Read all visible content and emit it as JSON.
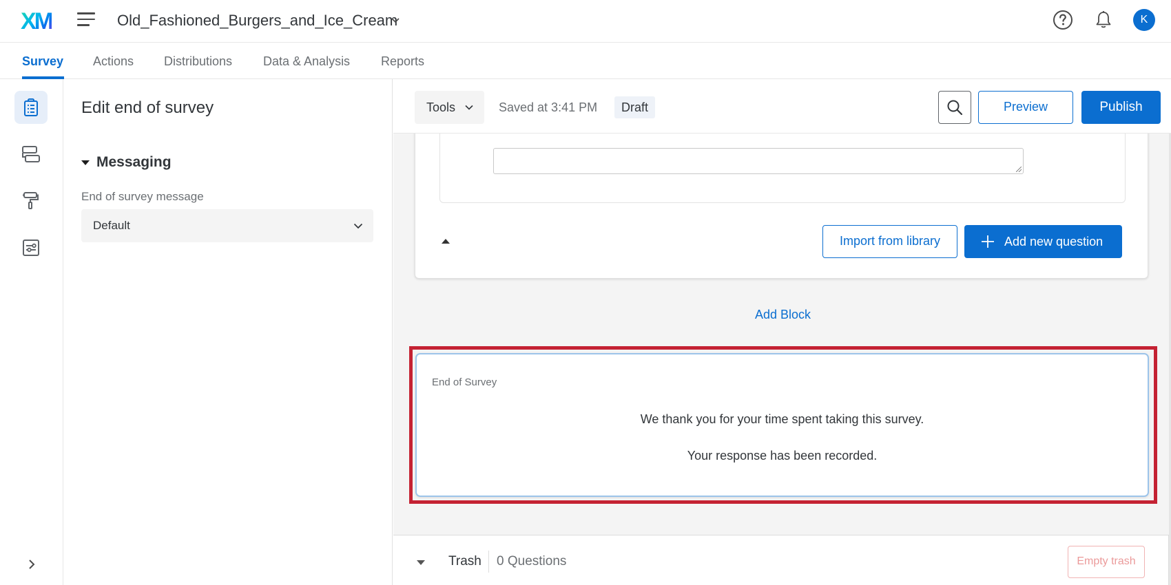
{
  "header": {
    "logo": "XM",
    "project_title": "Old_Fashioned_Burgers_and_Ice_Cream",
    "avatar_initial": "K",
    "icons": [
      "menu-icon",
      "help-icon",
      "bell-icon"
    ]
  },
  "tabs": [
    {
      "label": "Survey",
      "active": true
    },
    {
      "label": "Actions",
      "active": false
    },
    {
      "label": "Distributions",
      "active": false
    },
    {
      "label": "Data & Analysis",
      "active": false
    },
    {
      "label": "Reports",
      "active": false
    }
  ],
  "rail": {
    "items": [
      {
        "icon": "survey-clipboard-icon",
        "active": true
      },
      {
        "icon": "survey-flow-icon",
        "active": false
      },
      {
        "icon": "look-and-feel-paint-roller-icon",
        "active": false
      },
      {
        "icon": "survey-options-sliders-icon",
        "active": false
      }
    ],
    "expand_icon": "chevron-right-icon"
  },
  "panel": {
    "title": "Edit end of survey",
    "section": "Messaging",
    "field_label": "End of survey message",
    "select_value": "Default"
  },
  "toolbar": {
    "tools_label": "Tools",
    "saved_text": "Saved at 3:41 PM",
    "status_badge": "Draft",
    "preview_label": "Preview",
    "publish_label": "Publish"
  },
  "block": {
    "import_label": "Import from library",
    "add_question_label": "Add new question"
  },
  "add_block_label": "Add Block",
  "end_of_survey": {
    "label": "End of Survey",
    "message_line1": "We thank you for your time spent taking this survey.",
    "message_line2": "Your response has been recorded.",
    "highlight_color": "#c42233"
  },
  "trash": {
    "label": "Trash",
    "count": "0 Questions",
    "empty_label": "Empty trash"
  },
  "colors": {
    "accent": "#0b6ed0",
    "highlight": "#c42233"
  }
}
